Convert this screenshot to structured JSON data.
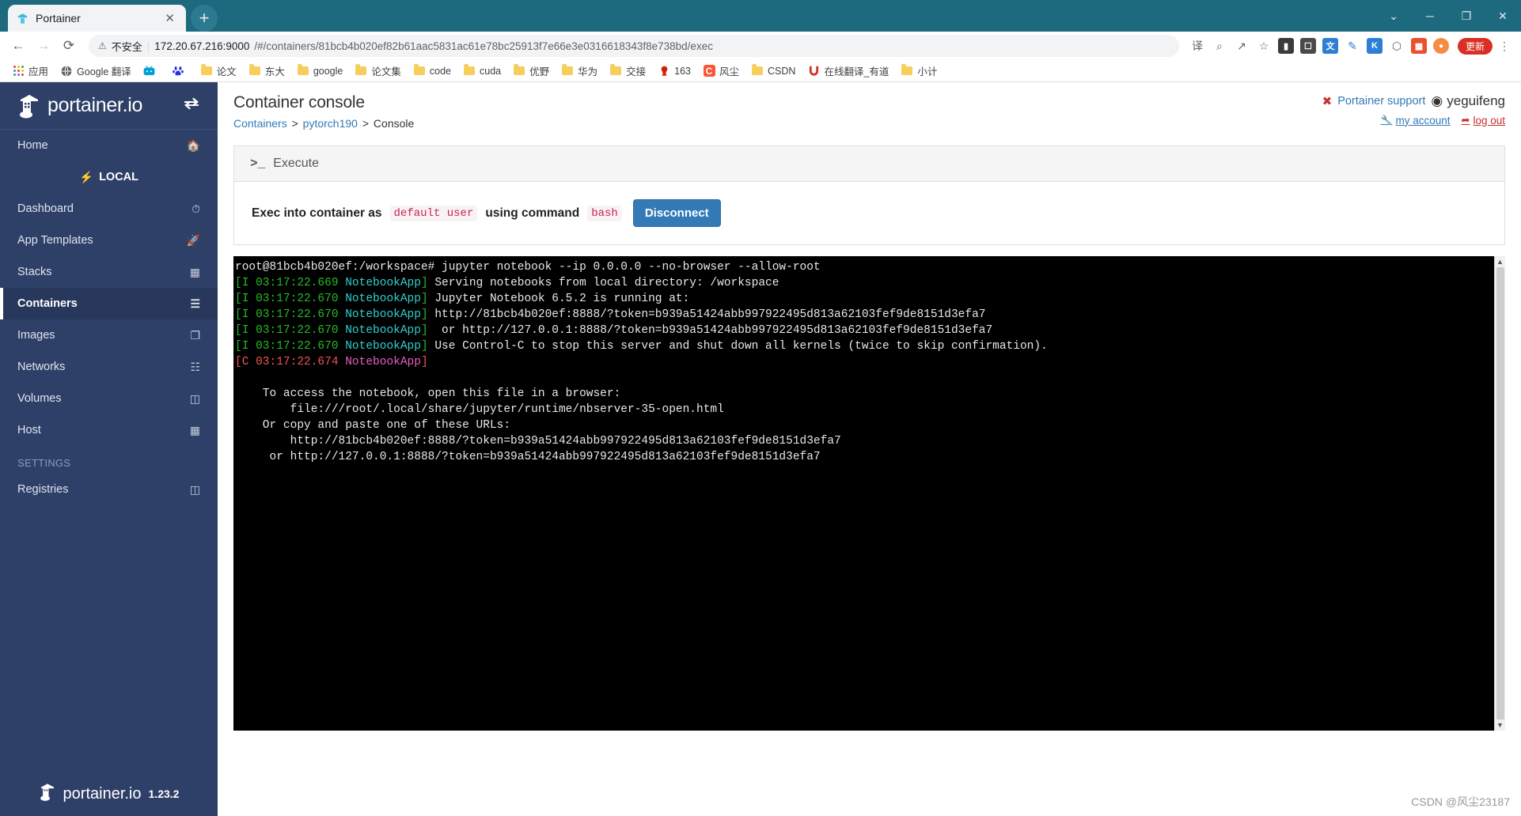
{
  "browser": {
    "tab": {
      "title": "Portainer",
      "favicon": "portainer-favicon",
      "close_label": "✕"
    },
    "new_tab_label": "+",
    "window_controls": {
      "minimize": "─",
      "maximize": "❐",
      "close": "✕",
      "chevron": "⌄"
    },
    "nav": {
      "back": "←",
      "forward": "→",
      "reload": "⟳"
    },
    "address": {
      "warning_icon": "⚠",
      "security_label": "不安全",
      "host": "172.20.67.216:9000",
      "path": "/#/containers/81bcb4b020ef82b61aac5831ac61e78bc25913f7e66e3e0316618343f8e738bd/exec",
      "full_url": "172.20.67.216:9000/#/containers/81bcb4b020ef82b61aac5831ac61e78bc25913f7e66e3e0316618343f8e738bd/exec"
    },
    "toolbar_icons": [
      {
        "name": "translate-icon",
        "glyph": "译"
      },
      {
        "name": "zoom-icon",
        "glyph": "⌕"
      },
      {
        "name": "share-icon",
        "glyph": "↗"
      },
      {
        "name": "bookmark-star-icon",
        "glyph": "☆"
      },
      {
        "name": "wallet-extension-icon",
        "glyph": "▬"
      },
      {
        "name": "capture-extension-icon",
        "glyph": "⬜"
      },
      {
        "name": "translate-extension-icon",
        "glyph": "文"
      },
      {
        "name": "pen-extension-icon",
        "glyph": "✎"
      },
      {
        "name": "k-extension-icon",
        "glyph": "K"
      },
      {
        "name": "puzzle-extensions-icon",
        "glyph": "⬡"
      },
      {
        "name": "grid-extension-icon",
        "glyph": "▦"
      }
    ],
    "update_button": "更新",
    "menu_icon": "⋮",
    "bookmarks": [
      {
        "label": "应用",
        "icon": "apps-grid-icon",
        "type": "apps"
      },
      {
        "label": "Google 翻译",
        "icon": "translate-icon",
        "type": "globe"
      },
      {
        "label": "",
        "icon": "bilibili-icon",
        "type": "bilibili"
      },
      {
        "label": "",
        "icon": "baidu-icon",
        "type": "baidu"
      },
      {
        "label": "论文",
        "icon": "folder-icon",
        "type": "folder"
      },
      {
        "label": "东大",
        "icon": "folder-icon",
        "type": "folder"
      },
      {
        "label": "google",
        "icon": "folder-icon",
        "type": "folder"
      },
      {
        "label": "论文集",
        "icon": "folder-icon",
        "type": "folder"
      },
      {
        "label": "code",
        "icon": "folder-icon",
        "type": "folder"
      },
      {
        "label": "cuda",
        "icon": "folder-icon",
        "type": "folder"
      },
      {
        "label": "优野",
        "icon": "folder-icon",
        "type": "folder"
      },
      {
        "label": "华为",
        "icon": "folder-icon",
        "type": "folder"
      },
      {
        "label": "交接",
        "icon": "folder-icon",
        "type": "folder"
      },
      {
        "label": "163",
        "icon": "netease-icon",
        "type": "netease"
      },
      {
        "label": "风尘",
        "icon": "csdn-icon",
        "type": "csdn"
      },
      {
        "label": "CSDN",
        "icon": "folder-icon",
        "type": "folder"
      },
      {
        "label": "在线翻译_有道",
        "icon": "youdao-icon",
        "type": "youdao"
      },
      {
        "label": "小计",
        "icon": "folder-icon",
        "type": "folder"
      }
    ]
  },
  "sidebar": {
    "brand": "portainer.io",
    "toggle_icon": "collapse-arrows-icon",
    "home": {
      "label": "Home",
      "icon": "home-icon"
    },
    "environment": {
      "label": "LOCAL",
      "icon": "plug-icon"
    },
    "items": [
      {
        "label": "Dashboard",
        "icon": "gauge-icon",
        "active": false
      },
      {
        "label": "App Templates",
        "icon": "rocket-icon",
        "active": false
      },
      {
        "label": "Stacks",
        "icon": "list-icon",
        "active": false
      },
      {
        "label": "Containers",
        "icon": "containers-icon",
        "active": true
      },
      {
        "label": "Images",
        "icon": "images-icon",
        "active": false
      },
      {
        "label": "Networks",
        "icon": "network-icon",
        "active": false
      },
      {
        "label": "Volumes",
        "icon": "volumes-icon",
        "active": false
      },
      {
        "label": "Host",
        "icon": "host-grid-icon",
        "active": false
      }
    ],
    "settings_title": "SETTINGS",
    "settings_items": [
      {
        "label": "Registries",
        "icon": "database-icon",
        "active": false
      }
    ],
    "footer": {
      "brand": "portainer.io",
      "version": "1.23.2"
    }
  },
  "header": {
    "title": "Container console",
    "breadcrumb": [
      {
        "label": "Containers",
        "link": true
      },
      {
        "label": "pytorch190",
        "link": true
      },
      {
        "label": "Console",
        "link": false
      }
    ],
    "breadcrumb_sep": ">",
    "support_label": "Portainer support",
    "support_icon": "lifebuoy-icon",
    "user_name": "yeguifeng",
    "user_icon": "user-circle-icon",
    "my_account_label": "my account",
    "my_account_icon": "wrench-icon",
    "logout_label": "log out",
    "logout_icon": "exit-icon"
  },
  "exec_panel": {
    "heading": "Execute",
    "prompt_icon": ">_",
    "text_before": "Exec into container as",
    "user_chip": "default user",
    "text_middle": "using command",
    "command_chip": "bash",
    "disconnect_label": "Disconnect"
  },
  "terminal": {
    "scrollbar": {
      "up_arrow": "▲",
      "down_arrow": "▼"
    },
    "lines": [
      [
        {
          "t": "root@81bcb4b020ef:/workspace# jupyter notebook --ip 0.0.0.0 --no-browser --allow-root",
          "c": "t-white"
        }
      ],
      [
        {
          "t": "[I 03:17:22.669 ",
          "c": "t-green"
        },
        {
          "t": "NotebookApp",
          "c": "t-cyan"
        },
        {
          "t": "] ",
          "c": "t-green"
        },
        {
          "t": "Serving notebooks from local directory: /workspace",
          "c": "t-white"
        }
      ],
      [
        {
          "t": "[I 03:17:22.670 ",
          "c": "t-green"
        },
        {
          "t": "NotebookApp",
          "c": "t-cyan"
        },
        {
          "t": "] ",
          "c": "t-green"
        },
        {
          "t": "Jupyter Notebook 6.5.2 is running at:",
          "c": "t-white"
        }
      ],
      [
        {
          "t": "[I 03:17:22.670 ",
          "c": "t-green"
        },
        {
          "t": "NotebookApp",
          "c": "t-cyan"
        },
        {
          "t": "] ",
          "c": "t-green"
        },
        {
          "t": "http://81bcb4b020ef:8888/?token=b939a51424abb997922495d813a62103fef9de8151d3efa7",
          "c": "t-white"
        }
      ],
      [
        {
          "t": "[I 03:17:22.670 ",
          "c": "t-green"
        },
        {
          "t": "NotebookApp",
          "c": "t-cyan"
        },
        {
          "t": "] ",
          "c": "t-green"
        },
        {
          "t": " or http://127.0.0.1:8888/?token=b939a51424abb997922495d813a62103fef9de8151d3efa7",
          "c": "t-white"
        }
      ],
      [
        {
          "t": "[I 03:17:22.670 ",
          "c": "t-green"
        },
        {
          "t": "NotebookApp",
          "c": "t-cyan"
        },
        {
          "t": "] ",
          "c": "t-green"
        },
        {
          "t": "Use Control-C to stop this server and shut down all kernels (twice to skip confirmation).",
          "c": "t-white"
        }
      ],
      [
        {
          "t": "[C 03:17:22.674 ",
          "c": "t-red"
        },
        {
          "t": "NotebookApp",
          "c": "t-pink"
        },
        {
          "t": "]",
          "c": "t-red"
        }
      ],
      [
        {
          "t": "",
          "c": "t-white"
        }
      ],
      [
        {
          "t": "    To access the notebook, open this file in a browser:",
          "c": "t-white"
        }
      ],
      [
        {
          "t": "        file:///root/.local/share/jupyter/runtime/nbserver-35-open.html",
          "c": "t-white"
        }
      ],
      [
        {
          "t": "    Or copy and paste one of these URLs:",
          "c": "t-white"
        }
      ],
      [
        {
          "t": "        http://81bcb4b020ef:8888/?token=b939a51424abb997922495d813a62103fef9de8151d3efa7",
          "c": "t-white"
        }
      ],
      [
        {
          "t": "     or http://127.0.0.1:8888/?token=b939a51424abb997922495d813a62103fef9de8151d3efa7",
          "c": "t-white"
        }
      ]
    ]
  },
  "watermark": "CSDN @风尘23187"
}
